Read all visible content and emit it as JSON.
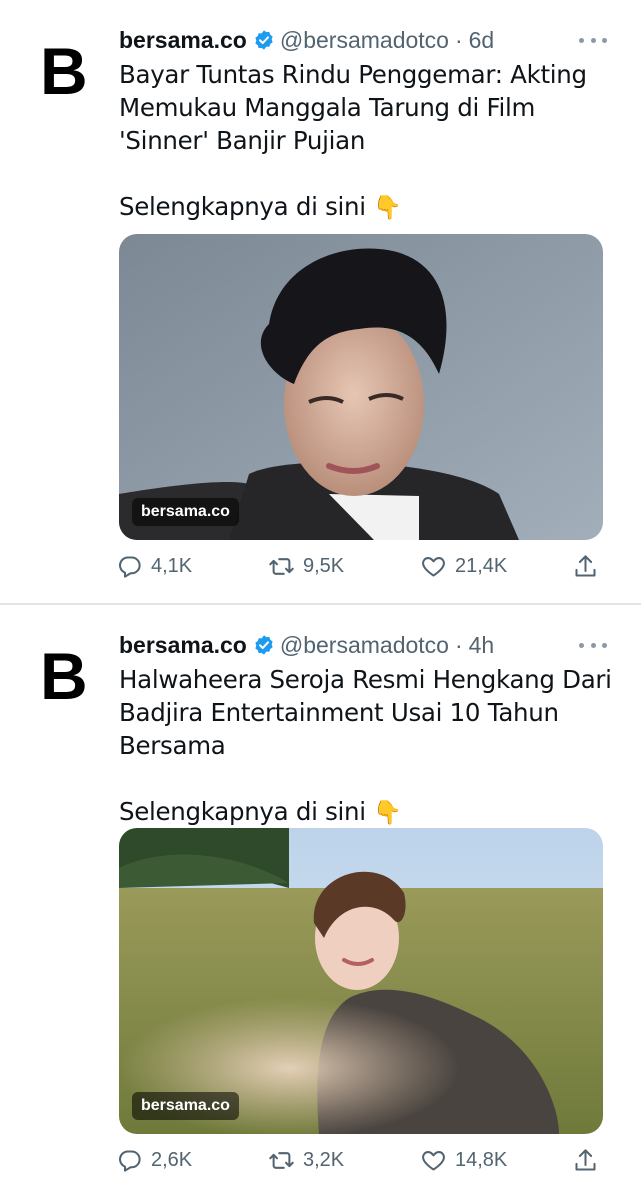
{
  "tweets": [
    {
      "avatar_letter": "B",
      "display_name": "bersama.co",
      "handle": "@bersamadotco",
      "separator": "·",
      "time": "6d",
      "text": "Bayar Tuntas Rindu Penggemar: Akting Memukau Manggala Tarung di Film 'Sinner' Banjir Pujian",
      "cta": "Selengkapnya di sini",
      "cta_emoji": "👇",
      "image_watermark": "bersama.co",
      "replies": "4,1K",
      "retweets": "9,5K",
      "likes": "21,4K"
    },
    {
      "avatar_letter": "B",
      "display_name": "bersama.co",
      "handle": "@bersamadotco",
      "separator": "·",
      "time": "4h",
      "text": "Halwaheera Seroja Resmi Hengkang Dari Badjira Entertainment Usai 10 Tahun Bersama",
      "cta": "Selengkapnya di sini",
      "cta_emoji": "👇",
      "image_watermark": "bersama.co",
      "replies": "2,6K",
      "retweets": "3,2K",
      "likes": "14,8K"
    }
  ],
  "icons": {
    "verified": "verified-badge-icon",
    "more": "more-icon",
    "reply": "reply-icon",
    "retweet": "retweet-icon",
    "like": "heart-icon",
    "share": "share-icon"
  },
  "colors": {
    "verified_blue": "#1d9bf0",
    "muted": "#536471",
    "text": "#0f1419"
  }
}
